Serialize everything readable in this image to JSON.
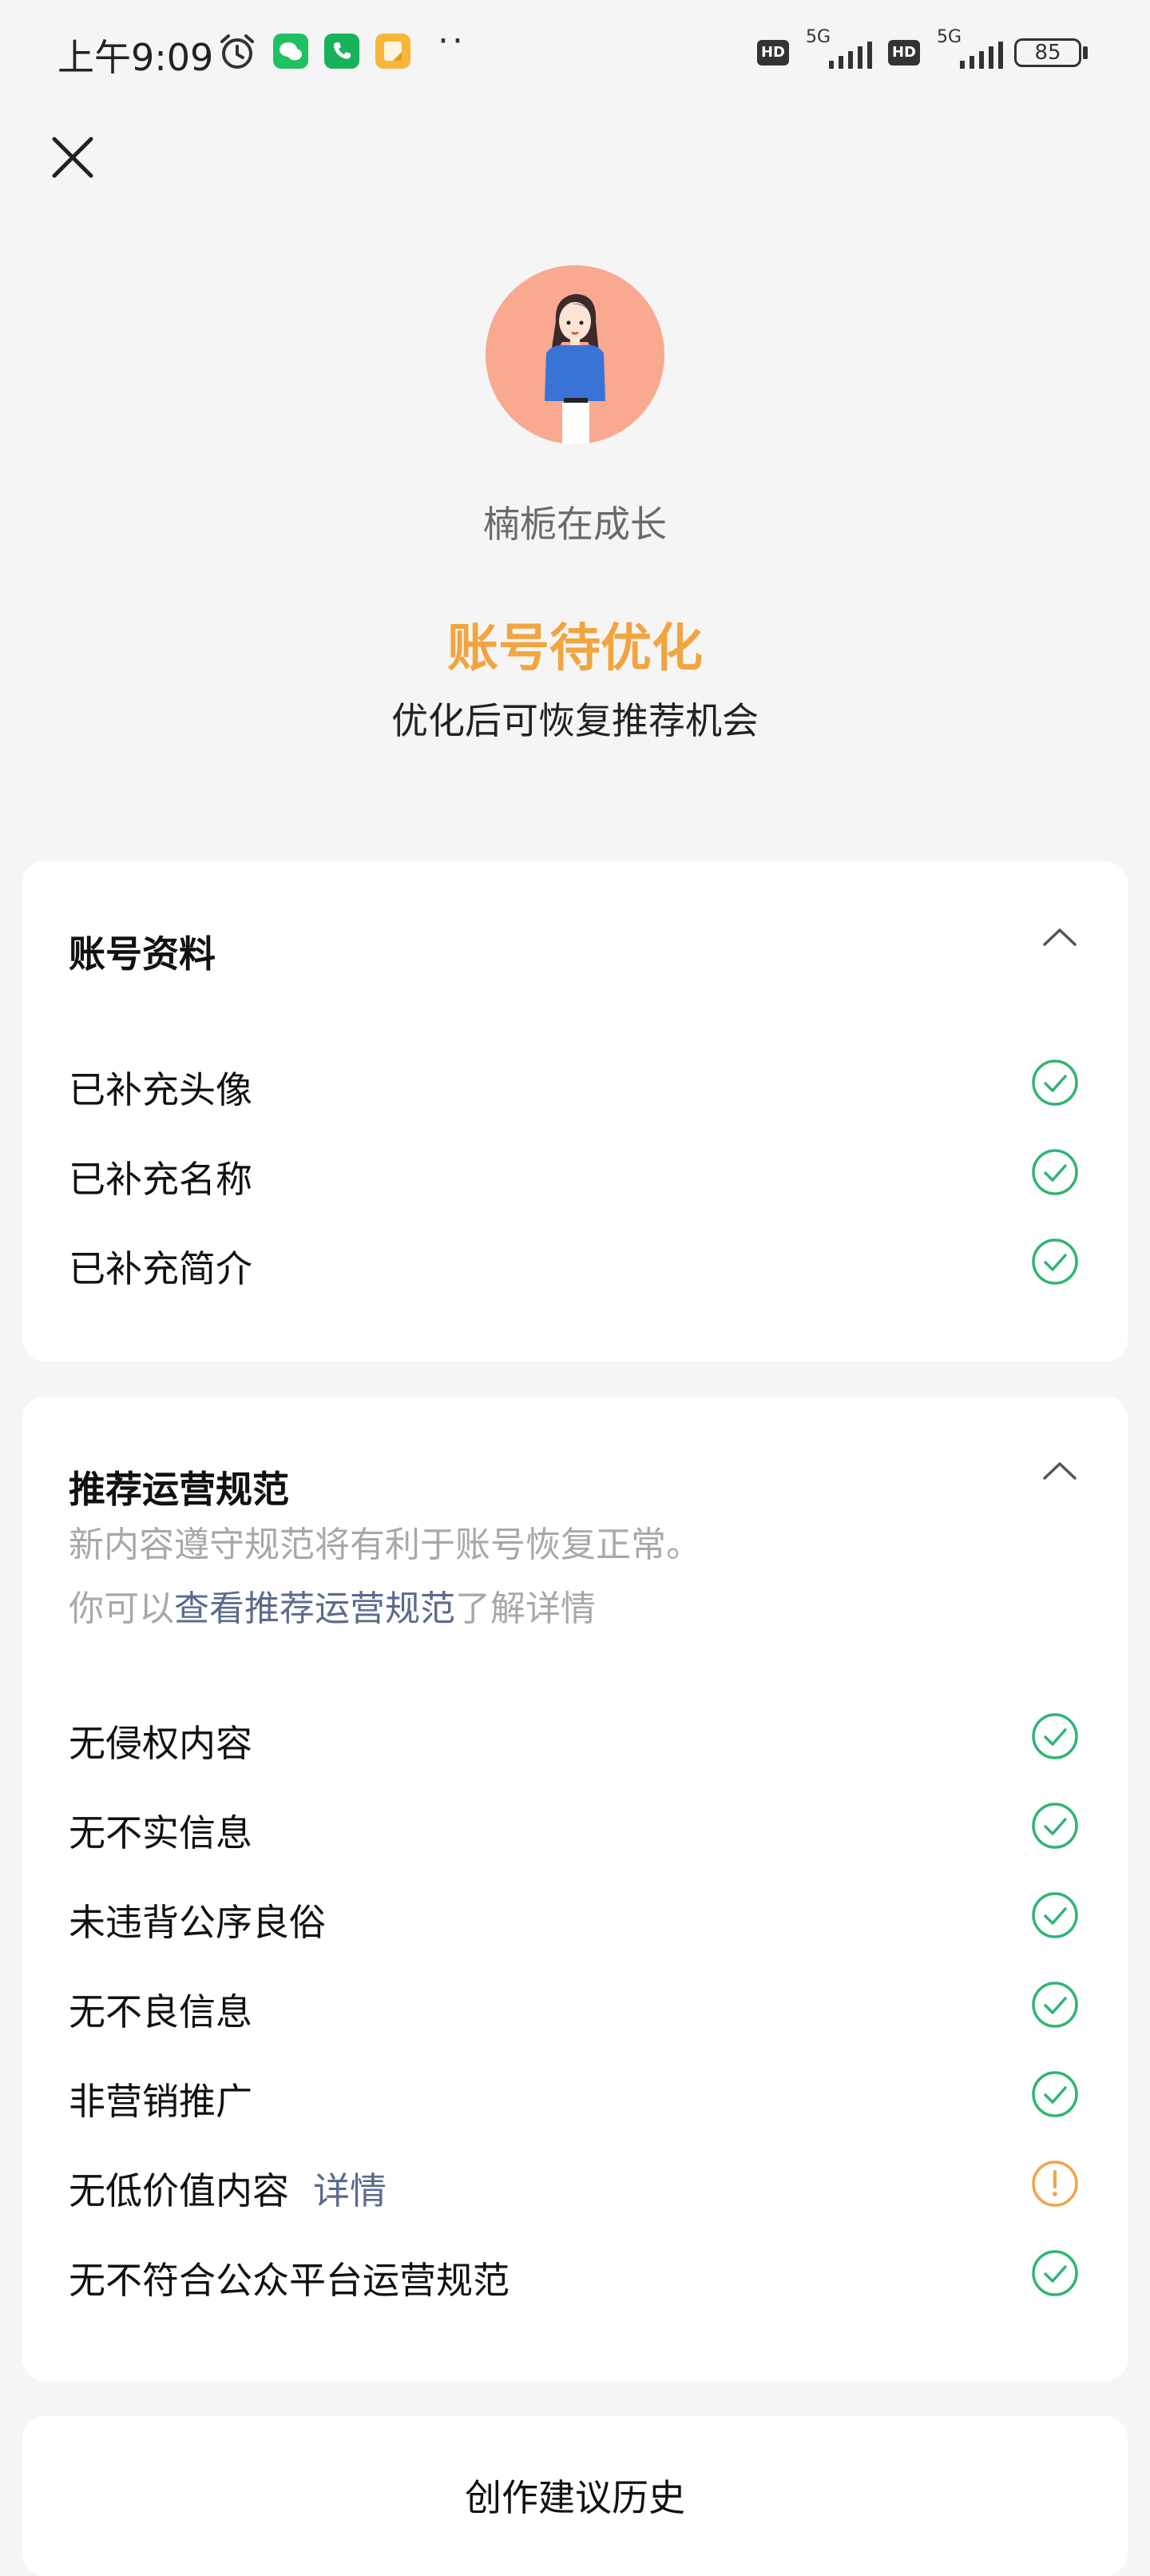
{
  "status_bar": {
    "time": "上午9:09",
    "hd_label": "HD",
    "network_label": "5G",
    "battery": "85"
  },
  "profile": {
    "username": "楠栀在成长",
    "status_title": "账号待优化",
    "status_subtitle": "优化后可恢复推荐机会"
  },
  "account_info": {
    "title": "账号资料",
    "items": [
      {
        "label": "已补充头像",
        "status": "ok"
      },
      {
        "label": "已补充名称",
        "status": "ok"
      },
      {
        "label": "已补充简介",
        "status": "ok"
      }
    ]
  },
  "guidelines": {
    "title": "推荐运营规范",
    "desc_line1": "新内容遵守规范将有利于账号恢复正常。",
    "desc_prefix": "你可以",
    "desc_link": "查看推荐运营规范",
    "desc_suffix": "了解详情",
    "items": [
      {
        "label": "无侵权内容",
        "status": "ok"
      },
      {
        "label": "无不实信息",
        "status": "ok"
      },
      {
        "label": "未违背公序良俗",
        "status": "ok"
      },
      {
        "label": "无不良信息",
        "status": "ok"
      },
      {
        "label": "非营销推广",
        "status": "ok"
      },
      {
        "label": "无低价值内容",
        "link": "详情",
        "status": "warning"
      },
      {
        "label": "无不符合公众平台运营规范",
        "status": "ok"
      }
    ]
  },
  "history": {
    "label": "创作建议历史"
  },
  "colors": {
    "accent_orange": "#f2a440",
    "ok_green": "#2fb574",
    "warning_orange": "#f0a447",
    "link_blue": "#5b6b8d"
  }
}
